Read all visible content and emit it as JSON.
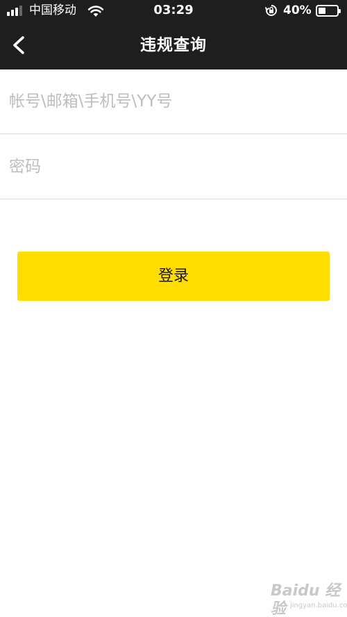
{
  "status_bar": {
    "carrier": "中国移动",
    "time": "03:29",
    "battery_percent": "40%",
    "battery_level": 0.4,
    "signal_bars": 3,
    "icons": [
      "signal-icon",
      "wifi-icon",
      "orientation-lock-icon",
      "battery-icon"
    ]
  },
  "nav": {
    "title": "违规查询",
    "back_icon": "chevron-left-icon"
  },
  "form": {
    "account_placeholder": "帐号\\邮箱\\手机号\\YY号",
    "account_value": "",
    "password_placeholder": "密码",
    "password_value": ""
  },
  "login_button": {
    "label": "登录",
    "color": "#FFDE00"
  },
  "watermark": {
    "text": "Baidu 经验",
    "url": "jingyan.baidu.com"
  },
  "colors": {
    "header_bg": "#1E1E1E",
    "divider": "#DCDCDC",
    "placeholder": "#BDBDBD"
  }
}
